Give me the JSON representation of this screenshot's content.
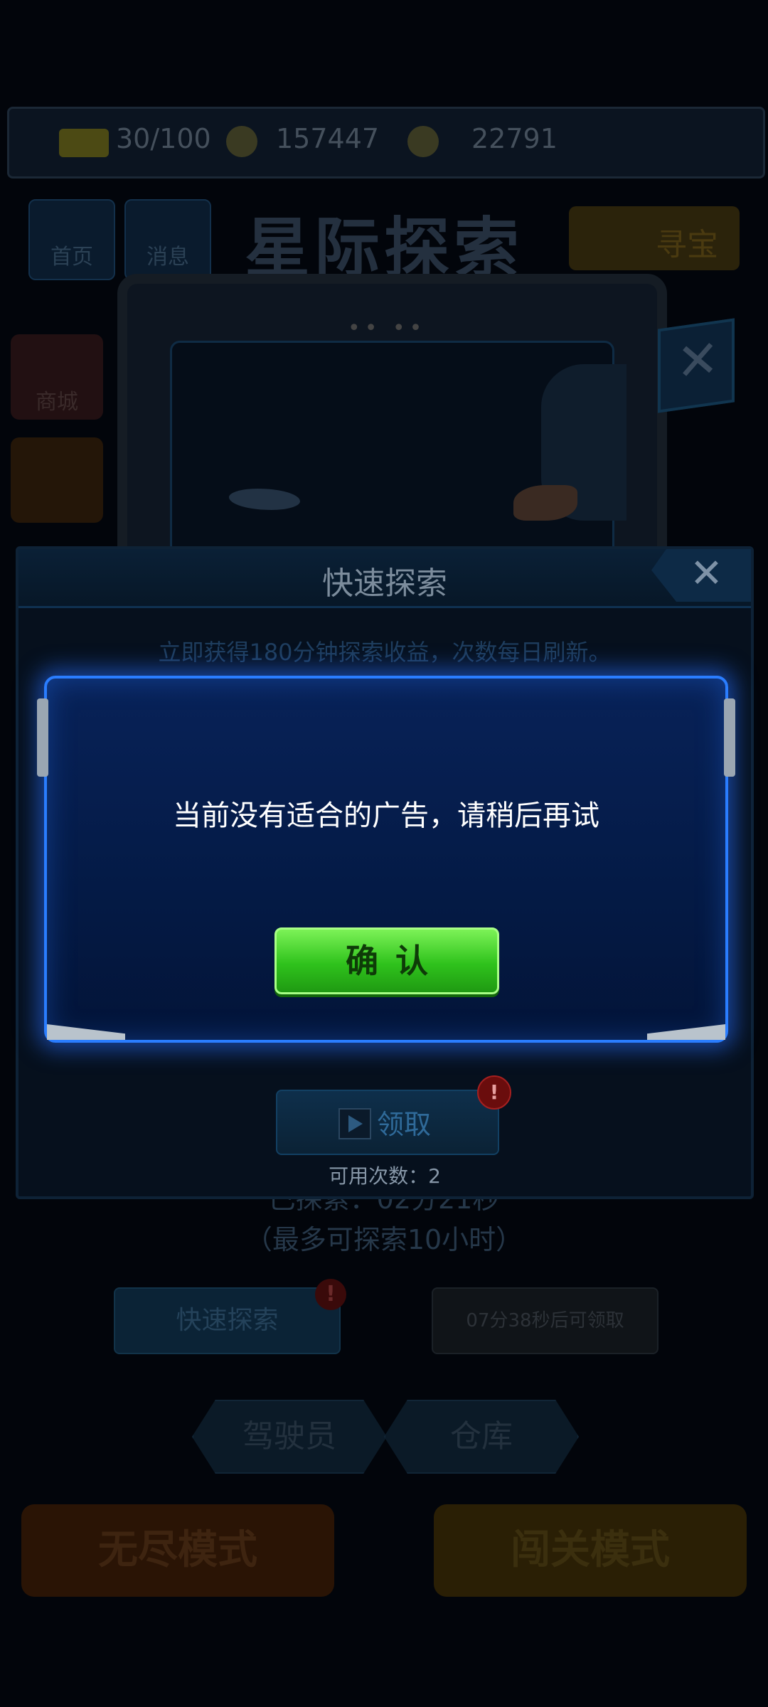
{
  "status_bar": {
    "level_progress": "30/100",
    "coins": "157447",
    "parts": "22791"
  },
  "nav": {
    "home": "首页",
    "messages": "消息",
    "title": "星际探索",
    "treasure": "寻宝"
  },
  "side": {
    "shop": "商城"
  },
  "background_panel": {
    "explore_time_label": "已探索：",
    "explore_time_value": "02分21秒",
    "max_explore": "（最多可探索10小时）",
    "quick_explore_button": "快速探索",
    "claim_later_button": "07分38秒后可领取"
  },
  "bottom_tabs": {
    "pilot": "驾驶员",
    "warehouse": "仓库"
  },
  "modes": {
    "endless": "无尽模式",
    "stage": "闯关模式"
  },
  "quick_explore_dialog": {
    "title": "快速探索",
    "close_glyph": "✕",
    "description": "立即获得180分钟探索收益，次数每日刷新。",
    "claim_label": "领取",
    "badge": "!",
    "count_label": "可用次数：2"
  },
  "alert": {
    "message": "当前没有适合的广告，请稍后再试",
    "confirm_label": "确认"
  },
  "colors": {
    "alert_border": "#2a7dff",
    "confirm_green": "#2fc21c",
    "badge_red": "#a42020"
  }
}
